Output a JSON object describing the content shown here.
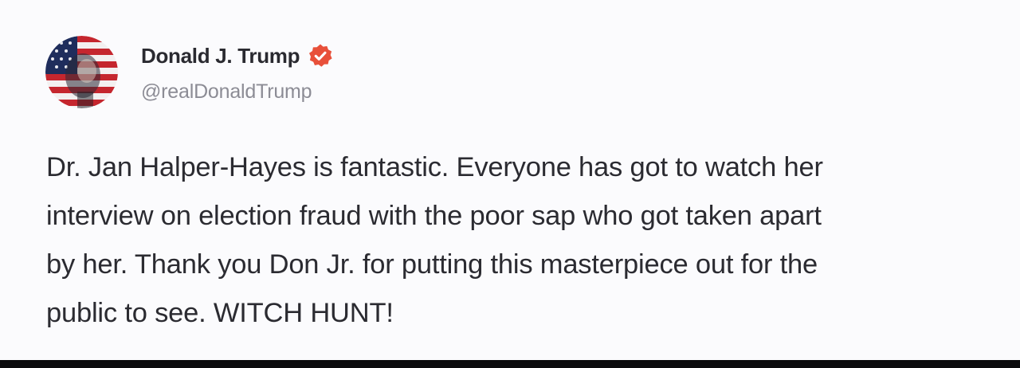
{
  "post": {
    "author": {
      "display_name": "Donald J. Trump",
      "handle": "@realDonaldTrump",
      "verified_icon": "verified-badge-icon",
      "avatar_icon": "profile-avatar-flag"
    },
    "body_lines": [
      "Dr. Jan Halper-Hayes is fantastic. Everyone has got to watch her",
      "interview on election fraud with the poor sap who got taken apart",
      "by her. Thank you Don Jr. for putting this masterpiece out for the",
      "public to see. WITCH HUNT!"
    ]
  },
  "colors": {
    "background": "#fbfbfd",
    "text": "#2b2b31",
    "handle": "#8c8c95",
    "verified_badge": "#e8503a",
    "bottom_bar": "#0b0b0d"
  }
}
